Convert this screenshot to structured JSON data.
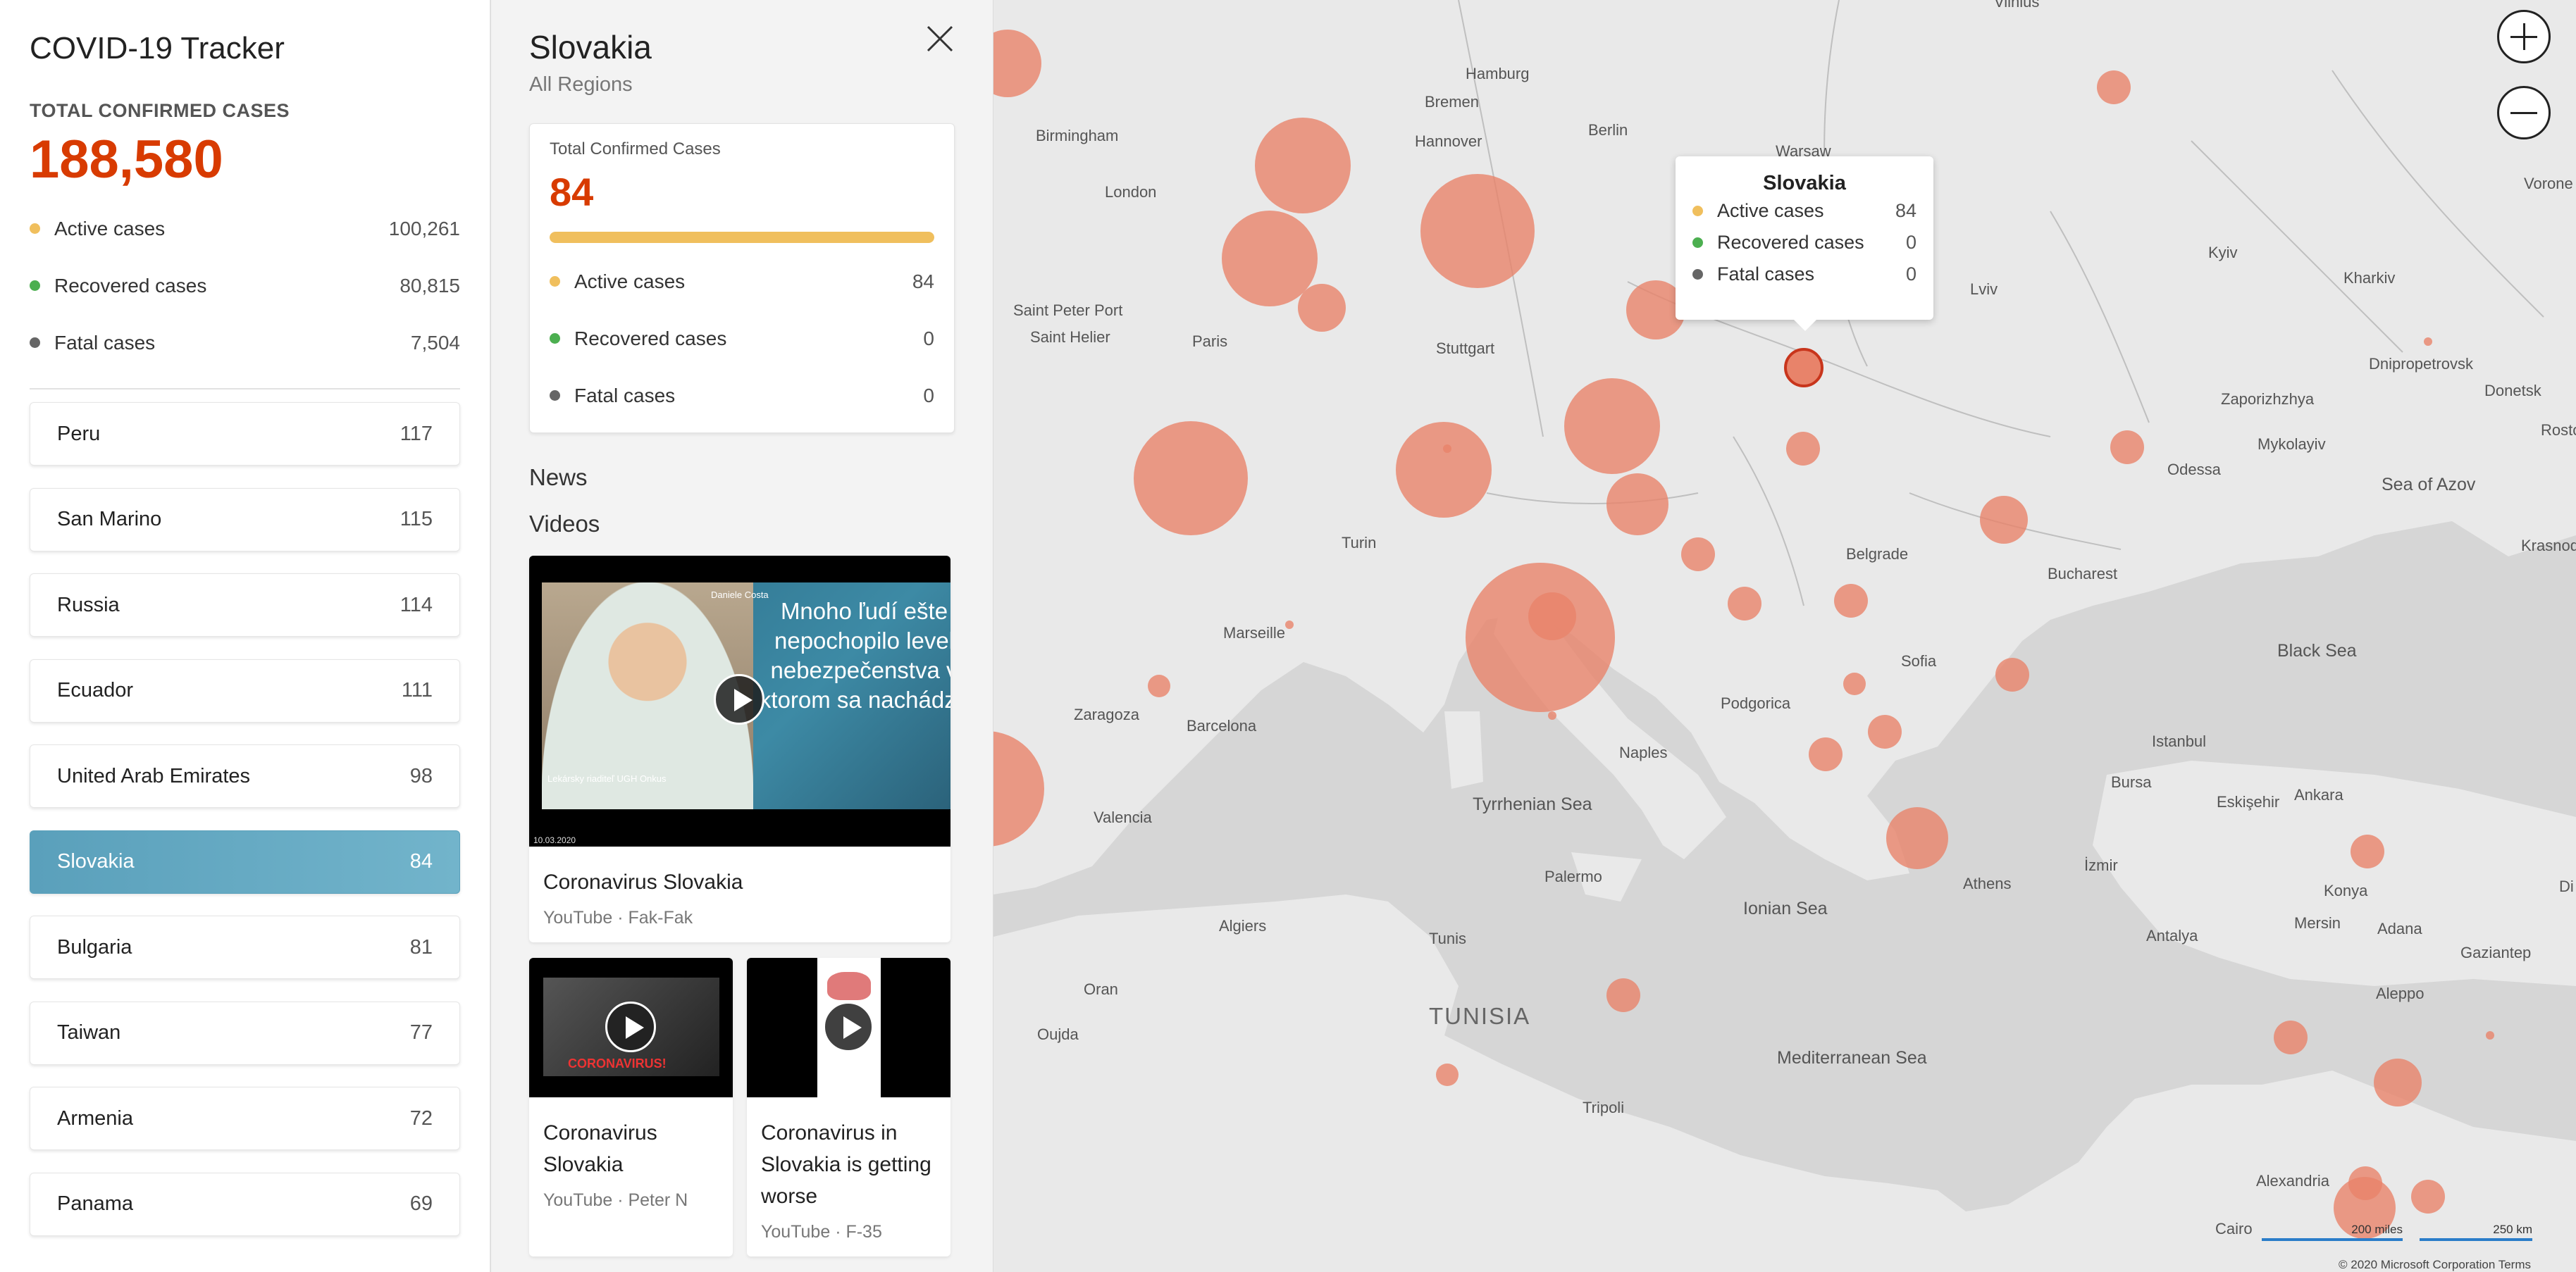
{
  "sidebar": {
    "app_title": "COVID-19 Tracker",
    "total_label": "TOTAL CONFIRMED CASES",
    "total_value": "188,580",
    "stats": [
      {
        "label": "Active cases",
        "value": "100,261",
        "color": "#f0bf5d"
      },
      {
        "label": "Recovered cases",
        "value": "80,815",
        "color": "#4caf50"
      },
      {
        "label": "Fatal cases",
        "value": "7,504",
        "color": "#666666"
      }
    ],
    "countries": [
      {
        "name": "Peru",
        "count": "117"
      },
      {
        "name": "San Marino",
        "count": "115"
      },
      {
        "name": "Russia",
        "count": "114"
      },
      {
        "name": "Ecuador",
        "count": "111"
      },
      {
        "name": "United Arab Emirates",
        "count": "98"
      },
      {
        "name": "Slovakia",
        "count": "84",
        "selected": true
      },
      {
        "name": "Bulgaria",
        "count": "81"
      },
      {
        "name": "Taiwan",
        "count": "77"
      },
      {
        "name": "Armenia",
        "count": "72"
      },
      {
        "name": "Panama",
        "count": "69"
      }
    ]
  },
  "detail": {
    "title": "Slovakia",
    "subtitle": "All Regions",
    "card": {
      "label": "Total Confirmed Cases",
      "value": "84",
      "active_fraction": 1.0,
      "stats": [
        {
          "label": "Active cases",
          "value": "84",
          "color": "#f0bf5d"
        },
        {
          "label": "Recovered cases",
          "value": "0",
          "color": "#4caf50"
        },
        {
          "label": "Fatal cases",
          "value": "0",
          "color": "#666666"
        }
      ]
    },
    "news_heading": "News",
    "videos_heading": "Videos",
    "videos": [
      {
        "title": "Coronavirus Slovakia",
        "meta": "YouTube · Fak-Fak",
        "thumb_text": "Mnoho ľudí ešte nepochopilo level nebezpečenstva v ktorom sa nachádza",
        "thumb_presenter": "Daniele Costa",
        "thumb_caption": "Lekársky riaditeľ UGH Onkus",
        "thumb_date": "10.03.2020"
      },
      {
        "title": "Coronavirus Slovakia",
        "meta": "YouTube · Peter N",
        "thumb_text": "CORONAVIRUS!"
      },
      {
        "title": "Coronavirus in Slovakia is getting worse",
        "meta": "YouTube · F-35"
      }
    ]
  },
  "map": {
    "bubble_color": "#e8836a",
    "popup": {
      "title": "Slovakia",
      "stats": [
        {
          "label": "Active cases",
          "value": "84",
          "color": "#f0bf5d"
        },
        {
          "label": "Recovered cases",
          "value": "0",
          "color": "#4caf50"
        },
        {
          "label": "Fatal cases",
          "value": "0",
          "color": "#666666"
        }
      ]
    },
    "labels": [
      "Hamburg",
      "Bremen",
      "Hannover",
      "Berlin",
      "Warsaw",
      "Vilnius",
      "Birmingham",
      "London",
      "Paris",
      "Saint Peter Port",
      "Saint Helier",
      "Stuttgart",
      "Kyiv",
      "Kharkiv",
      "Lviv",
      "Dnipropetrovsk",
      "Donetsk",
      "Zaporizhzhya",
      "Mykolayiv",
      "Odessa",
      "Rostov",
      "Sea of Azov",
      "Krasnodar",
      "Turin",
      "Belgrade",
      "Bucharest",
      "Black Sea",
      "Marseille",
      "Zaragoza",
      "Barcelona",
      "Podgorica",
      "Sofia",
      "Istanbul",
      "Naples",
      "Valencia",
      "Tyrrhenian Sea",
      "Bursa",
      "Eskişehir",
      "Ankara",
      "İzmir",
      "Athens",
      "Konya",
      "Palermo",
      "Ionian Sea",
      "Algiers",
      "Tunis",
      "Antalya",
      "Adana",
      "Gaziantep",
      "Mersin",
      "Aleppo",
      "Oran",
      "Oujda",
      "TUNISIA",
      "Mediterranean Sea",
      "Tripoli",
      "Alexandria",
      "Cairo",
      "Vorone",
      "Di"
    ],
    "scale_miles": "200 miles",
    "scale_km": "250 km",
    "copyright": "© 2020 Microsoft Corporation  Terms"
  }
}
